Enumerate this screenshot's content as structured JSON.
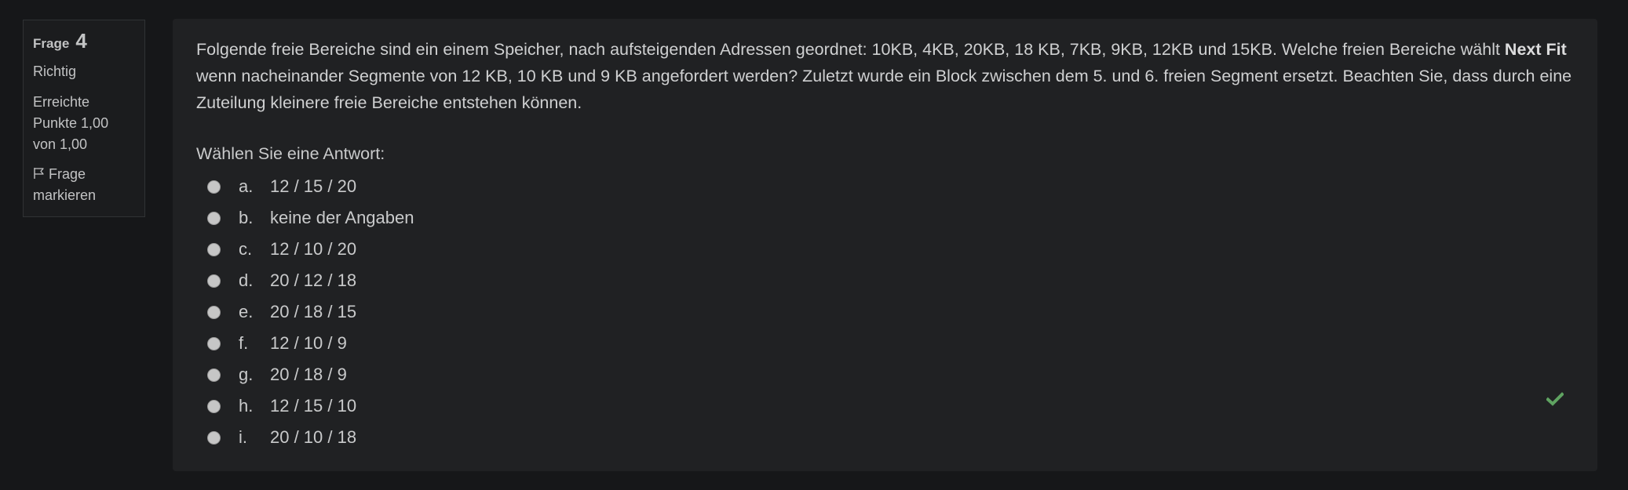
{
  "info": {
    "label": "Frage",
    "number": "4",
    "state": "Richtig",
    "grade": "Erreichte Punkte 1,00 von 1,00",
    "flag_label": "Frage markieren",
    "flag_icon": "flag-icon"
  },
  "question": {
    "text_part1": "Folgende freie Bereiche sind ein einem Speicher, nach aufsteigenden Adressen geordnet: 10KB, 4KB, 20KB, 18 KB, 7KB, 9KB, 12KB und 15KB. Welche freien Bereiche wählt ",
    "bold": "Next Fit",
    "text_part2": " wenn nacheinander Segmente von 12 KB, 10 KB und 9 KB angefordert werden? Zuletzt wurde ein Block zwischen dem 5. und 6. freien Segment ersetzt. Beachten Sie, dass durch eine Zuteilung kleinere freie Bereiche entstehen können.",
    "prompt": "Wählen Sie eine Antwort:"
  },
  "answers": [
    {
      "letter": "a.",
      "text": "12 / 15 / 20"
    },
    {
      "letter": "b.",
      "text": "keine der Angaben"
    },
    {
      "letter": "c.",
      "text": "12 / 10 / 20"
    },
    {
      "letter": "d.",
      "text": "20 / 12 / 18"
    },
    {
      "letter": "e.",
      "text": "20 / 18 / 15"
    },
    {
      "letter": "f.",
      "text": "12 / 10 / 9"
    },
    {
      "letter": "g.",
      "text": "20 / 18 / 9"
    },
    {
      "letter": "h.",
      "text": "12 / 15 / 10"
    },
    {
      "letter": "i.",
      "text": "20 / 10 / 18"
    }
  ],
  "correct_icon": "checkmark-icon",
  "colors": {
    "background": "#161719",
    "panel": "#202123",
    "check": "#5fa361"
  }
}
